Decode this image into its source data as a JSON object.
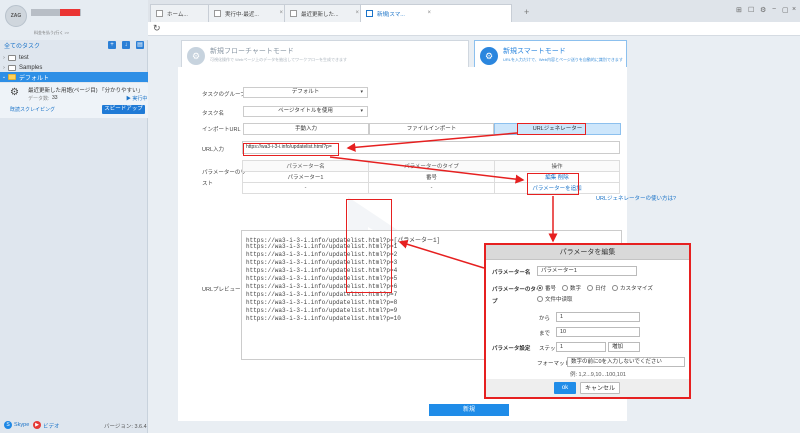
{
  "sidebar": {
    "avatar_label": "ZAG",
    "user_sub": "料金を払う(行く >>",
    "tasks_header": "全てのタスク",
    "folders": [
      {
        "label": "test",
        "expanded": false
      },
      {
        "label": "Samples",
        "expanded": false
      },
      {
        "label": "デフォルト",
        "expanded": true
      }
    ],
    "task": {
      "name": "最近更新した用語(ページ目) 「分かりやすい」",
      "status_label": "データ数:",
      "count": "33",
      "run_label": "▶ 実行中",
      "sub_label": "既読スクレイピング",
      "speedup_label": "スピードアップ"
    },
    "footer": {
      "skype_label": "Skype",
      "bilibili_label": "ビデオ",
      "version": "バージョン: 3.6.4"
    }
  },
  "tabs": [
    {
      "label": "ホーム..."
    },
    {
      "label": "実行中-最近..."
    },
    {
      "label": "最近更新した..."
    },
    {
      "label": "新規|スマ..."
    }
  ],
  "modes": {
    "flowchart": {
      "title": "新規フローチャートモード",
      "desc": "可視化操作で Webページ上のデータを抽出してワークフローを生成できます"
    },
    "smart": {
      "title": "新規スマートモード",
      "desc": "URLを入力だけで、Web内容とページ送りを自動的に識別できます"
    }
  },
  "form": {
    "group_label": "タスクのグループ",
    "group_value": "デフォルト",
    "taskname_label": "タスク名",
    "taskname_value": "ページタイトルを使用",
    "import_label": "インポートURL",
    "import_tabs": [
      "手動入力",
      "ファイルインポート",
      "URLジェネレーター"
    ],
    "url_label": "URL入力",
    "url_value": "https://wa3-i-3-i.info/updatelist.html?p=",
    "param_list_label": "パラメーターのリスト",
    "param_headers": [
      "パラメーター名",
      "パラメーターのタイプ",
      "操作"
    ],
    "param_row": {
      "name": "パラメーター1",
      "type": "番号",
      "edit": "編集",
      "delete": "削除"
    },
    "param_row2": {
      "name": "-",
      "type": "-"
    },
    "add_param": "パラメーターを追加",
    "help_link": "URLジェネレーターの使い方は?",
    "preview_label": "URLプレビュー",
    "preview_lines": [
      "https://wa3-i-3-i.info/updatelist.html?p=[パラメーター1]",
      "https://wa3-i-3-i.info/updatelist.html?p=1",
      "https://wa3-i-3-i.info/updatelist.html?p=2",
      "https://wa3-i-3-i.info/updatelist.html?p=3",
      "https://wa3-i-3-i.info/updatelist.html?p=4",
      "https://wa3-i-3-i.info/updatelist.html?p=5",
      "https://wa3-i-3-i.info/updatelist.html?p=6",
      "https://wa3-i-3-i.info/updatelist.html?p=7",
      "https://wa3-i-3-i.info/updatelist.html?p=8",
      "https://wa3-i-3-i.info/updatelist.html?p=9",
      "https://wa3-i-3-i.info/updatelist.html?p=10"
    ],
    "submit_label": "新規"
  },
  "dialog": {
    "title": "パラメータを編集",
    "name_label": "パラメーター名",
    "name_value": "パラメーター1",
    "type_label": "パラメーターのタイプ",
    "type_options": [
      "番号",
      "数字",
      "日付",
      "カスタマイズ"
    ],
    "type_extra": "文件中读取",
    "from_label": "から",
    "from_value": "1",
    "to_label": "まで",
    "to_value": "10",
    "settings_label": "パラメータ設定",
    "step_label": "ステップ",
    "step_value": "1",
    "step_mode": "増加",
    "format_label": "フォーマット",
    "format_value": "数字の前に0を入力しないでください",
    "example": "例: 1,2...9,10...100,101",
    "ok_label": "ok",
    "cancel_label": "キャンセル"
  },
  "colors": {
    "accent": "#2b86de",
    "highlight": "#e62020",
    "active_folder": "#2e8fe6"
  }
}
